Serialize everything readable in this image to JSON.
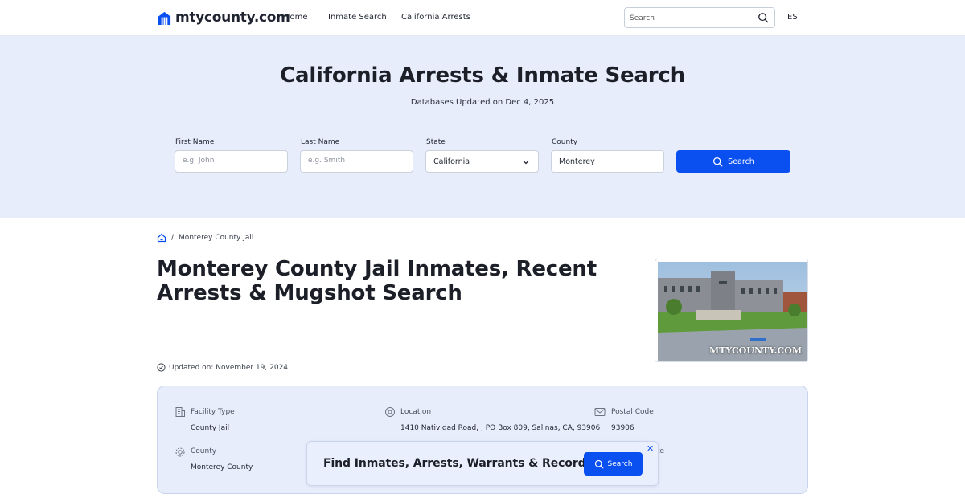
{
  "header": {
    "logo_text": "mtycounty.com",
    "nav": [
      "Home",
      "Inmate Search",
      "California Arrests"
    ],
    "search_placeholder": "Search",
    "lang": "ES"
  },
  "hero": {
    "title": "California Arrests & Inmate Search",
    "subtitle": "Databases Updated on Dec 4, 2025",
    "fields": {
      "first_name": {
        "label": "First Name",
        "placeholder": "e.g. John"
      },
      "last_name": {
        "label": "Last Name",
        "placeholder": "e.g. Smith"
      },
      "state": {
        "label": "State",
        "value": "California"
      },
      "county": {
        "label": "County",
        "value": "Monterey"
      }
    },
    "search_label": "Search"
  },
  "breadcrumb": {
    "separator": "/",
    "current": "Monterey County Jail"
  },
  "page": {
    "title": "Monterey County Jail Inmates, Recent Arrests & Mugshot Search",
    "updated": "Updated on: November 19, 2024",
    "photo_watermark": "MTYCOUNTY.COM"
  },
  "info": {
    "facility_type": {
      "label": "Facility Type",
      "value": "County Jail"
    },
    "location": {
      "label": "Location",
      "value": "1410 Natividad Road, , PO Box 809, Salinas, CA, 93906"
    },
    "postal_code": {
      "label": "Postal Code",
      "value": "93906"
    },
    "county": {
      "label": "County",
      "value": "Monterey County"
    },
    "state_partial": "te"
  },
  "cta": {
    "text": "Find Inmates, Arrests, Warrants & Records",
    "button": "Search",
    "close": "✕"
  },
  "colors": {
    "accent": "#0a4ff0",
    "hero_bg": "#e7edfb"
  }
}
